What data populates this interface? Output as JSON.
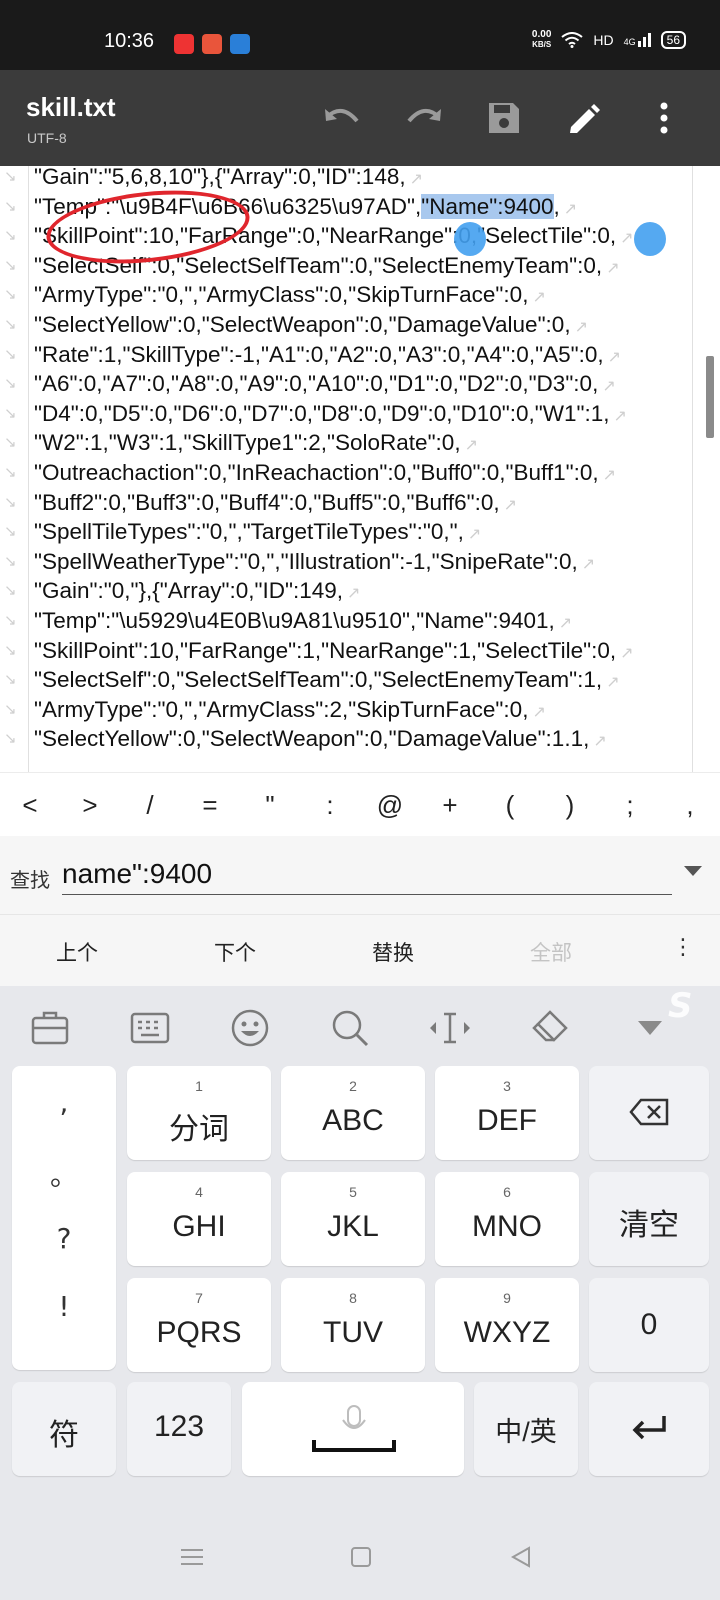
{
  "status_bar": {
    "time": "10:36",
    "net_speed_value": "0.00",
    "net_speed_unit": "KB/S",
    "hd": "HD",
    "signal": "4G",
    "battery": "56"
  },
  "app_bar": {
    "title": "skill.txt",
    "encoding": "UTF-8"
  },
  "editor": {
    "lines": [
      "\"Gain\":\"5,6,8,10\"},{\"Array\":0,\"ID\":148,",
      "\"Temp\":\"\\u9B4F\\u6B66\\u6325\\u97AD\",\"Name\":9400,",
      "\"SkillPoint\":10,\"FarRange\":0,\"NearRange\":0,\"SelectTile\":0,",
      "\"SelectSelf\":0,\"SelectSelfTeam\":0,\"SelectEnemyTeam\":0,",
      "\"ArmyType\":\"0,\",\"ArmyClass\":0,\"SkipTurnFace\":0,",
      "\"SelectYellow\":0,\"SelectWeapon\":0,\"DamageValue\":0,",
      "\"Rate\":1,\"SkillType\":-1,\"A1\":0,\"A2\":0,\"A3\":0,\"A4\":0,\"A5\":0,",
      "\"A6\":0,\"A7\":0,\"A8\":0,\"A9\":0,\"A10\":0,\"D1\":0,\"D2\":0,\"D3\":0,",
      "\"D4\":0,\"D5\":0,\"D6\":0,\"D7\":0,\"D8\":0,\"D9\":0,\"D10\":0,\"W1\":1,",
      "\"W2\":1,\"W3\":1,\"SkillType1\":2,\"SoloRate\":0,",
      "\"Outreachaction\":0,\"InReachaction\":0,\"Buff0\":0,\"Buff1\":0,",
      "\"Buff2\":0,\"Buff3\":0,\"Buff4\":0,\"Buff5\":0,\"Buff6\":0,",
      "\"SpellTileTypes\":\"0,\",\"TargetTileTypes\":\"0,\",",
      "\"SpellWeatherType\":\"0,\",\"Illustration\":-1,\"SnipeRate\":0,",
      "\"Gain\":\"0,\"},{\"Array\":0,\"ID\":149,",
      "\"Temp\":\"\\u5929\\u4E0B\\u9A81\\u9510\",\"Name\":9401,",
      "\"SkillPoint\":10,\"FarRange\":1,\"NearRange\":1,\"SelectTile\":0,",
      "\"SelectSelf\":0,\"SelectSelfTeam\":0,\"SelectEnemyTeam\":1,",
      "\"ArmyType\":\"0,\",\"ArmyClass\":2,\"SkipTurnFace\":0,",
      "\"SelectYellow\":0,\"SelectWeapon\":0,\"DamageValue\":1.1,"
    ],
    "highlight_prefix": "\"Temp\":\"\\u9B4F\\u6B66\\u6325\\u97AD\",",
    "highlight_text": "\"Name\":9400",
    "highlight_suffix": ","
  },
  "symbol_bar": [
    "<",
    ">",
    "/",
    "=",
    "\"",
    ":",
    "@",
    "+",
    "(",
    ")",
    ";",
    ","
  ],
  "find": {
    "label": "查找",
    "value": "name\":9400",
    "prev": "上个",
    "next": "下个",
    "replace": "替换",
    "all": "全部",
    "more": "⋮"
  },
  "keyboard": {
    "left_column": [
      ",",
      "。",
      "?",
      "!"
    ],
    "keys": [
      {
        "num": "1",
        "label": "分词"
      },
      {
        "num": "2",
        "label": "ABC"
      },
      {
        "num": "3",
        "label": "DEF"
      },
      {
        "num": "4",
        "label": "GHI"
      },
      {
        "num": "5",
        "label": "JKL"
      },
      {
        "num": "6",
        "label": "MNO"
      },
      {
        "num": "7",
        "label": "PQRS"
      },
      {
        "num": "8",
        "label": "TUV"
      },
      {
        "num": "9",
        "label": "WXYZ"
      }
    ],
    "clear": "清空",
    "zero": "0",
    "symbol": "符",
    "num123": "123",
    "lang": "中/英"
  },
  "colors": {
    "app_bar": "#3b3b3b",
    "status_bar": "#1a1a1a",
    "selection": "#a8c8ee",
    "annotation": "#e0262d",
    "keyboard_bg": "#e7e8ec"
  },
  "icons": [
    "undo-icon",
    "redo-icon",
    "save-icon",
    "edit-pencil-icon",
    "more-vert-icon",
    "wrap-arrow-icon",
    "backspace-icon",
    "enter-icon",
    "mic-icon",
    "emoji-icon",
    "search-icon",
    "cursor-icon",
    "clipboard-icon",
    "keyboard-icon",
    "eraser-icon",
    "collapse-icon"
  ]
}
